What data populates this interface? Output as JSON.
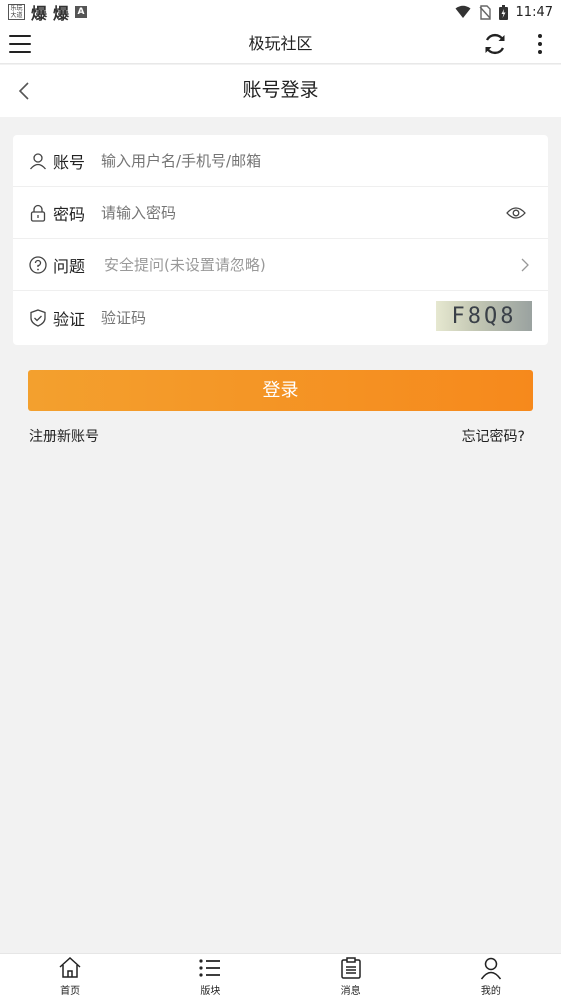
{
  "status_bar": {
    "app_icon_text": "乐玩大道",
    "glyph_1": "爆",
    "glyph_2": "爆",
    "badge": "A",
    "time": "11:47"
  },
  "app_bar": {
    "title": "极玩社区"
  },
  "page": {
    "title": "账号登录"
  },
  "form": {
    "account": {
      "label": "账号",
      "placeholder": "输入用户名/手机号/邮箱"
    },
    "password": {
      "label": "密码",
      "placeholder": "请输入密码"
    },
    "question": {
      "label": "问题",
      "placeholder": "安全提问(未设置请忽略)"
    },
    "verify": {
      "label": "验证",
      "placeholder": "验证码",
      "captcha_text": "F8Q8"
    }
  },
  "actions": {
    "login": "登录",
    "register": "注册新账号",
    "forgot": "忘记密码?"
  },
  "bottom_nav": {
    "items": [
      {
        "label": "首页",
        "icon": "home-icon"
      },
      {
        "label": "版块",
        "icon": "list-icon"
      },
      {
        "label": "消息",
        "icon": "message-icon"
      },
      {
        "label": "我的",
        "icon": "user-icon"
      }
    ]
  },
  "colors": {
    "accent": "#f6891c",
    "background": "#f2f2f2"
  }
}
